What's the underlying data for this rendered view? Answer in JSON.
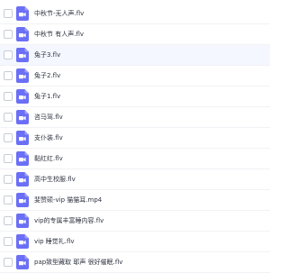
{
  "files": [
    {
      "name": "中秋节-无人声.flv",
      "icon": "video-file-icon",
      "selected": false
    },
    {
      "name": "中秋节 有人声.flv",
      "icon": "video-file-icon",
      "selected": false
    },
    {
      "name": "兔子3.flv",
      "icon": "video-file-icon",
      "selected": true
    },
    {
      "name": "兔子2.flv",
      "icon": "video-file-icon",
      "selected": false
    },
    {
      "name": "兔子1.flv",
      "icon": "video-file-icon",
      "selected": false
    },
    {
      "name": "咨马驾.flv",
      "icon": "video-file-icon",
      "selected": false
    },
    {
      "name": "支仆装.flv",
      "icon": "video-file-icon",
      "selected": false
    },
    {
      "name": "黏红红.flv",
      "icon": "video-file-icon",
      "selected": false
    },
    {
      "name": "高中生校服.flv",
      "icon": "video-file-icon",
      "selected": false
    },
    {
      "name": "斐赞硕-vip 猫猫耳.mp4",
      "icon": "video-file-icon",
      "selected": false
    },
    {
      "name": "vip的专属丰富睡内容.flv",
      "icon": "video-file-icon",
      "selected": false
    },
    {
      "name": "vip 睡觉礼.flv",
      "icon": "video-file-icon",
      "selected": false
    },
    {
      "name": "pap致型藏取 耶声 很好催眠.flv",
      "icon": "video-file-icon",
      "selected": false
    }
  ],
  "colors": {
    "icon": "#6b6ff5",
    "checkbox_border": "#c8ccd6",
    "text": "#2f3440",
    "row_divider": "#f1f2f5",
    "selected_row": "#f4f7ff"
  }
}
